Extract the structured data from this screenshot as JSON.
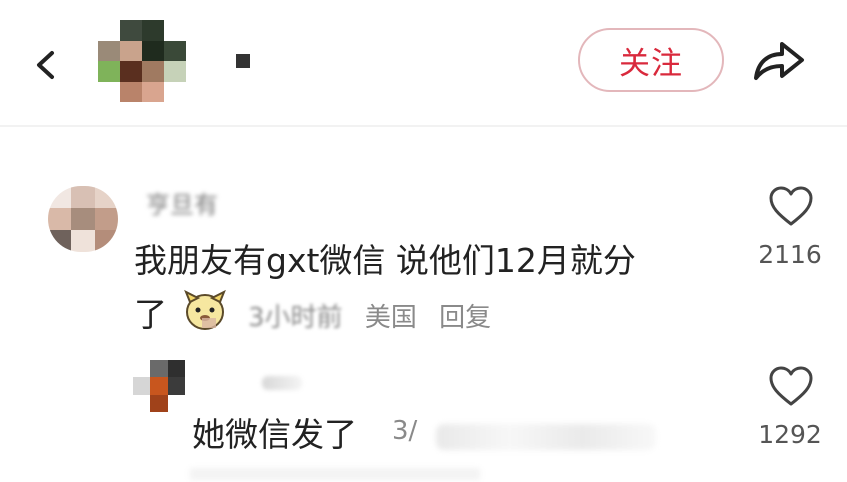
{
  "header": {
    "follow_label": "关注",
    "back_icon": "chevron-left-icon",
    "share_icon": "share-arrow-icon"
  },
  "colors": {
    "accent": "#d9293c",
    "follow_border": "#e3b7bb",
    "meta_text": "#8a8a8a"
  },
  "comments": [
    {
      "username_obscured": "亨旦有",
      "text_line1": "我朋友有gxt微信 说他们12月就分",
      "text_line2": "了",
      "time": "3小时前",
      "location": "美国",
      "reply_label": "回复",
      "like_count": "2116",
      "sticker_icon": "dog-sticker-icon"
    },
    {
      "text": "她微信发了",
      "time_partial": "3/",
      "like_count": "1292"
    }
  ]
}
